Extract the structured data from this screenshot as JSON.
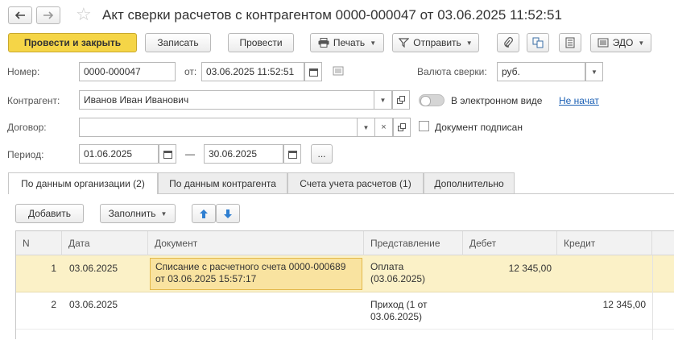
{
  "window": {
    "title": "Акт сверки расчетов с контрагентом 0000-000047 от 03.06.2025 11:52:51"
  },
  "toolbar": {
    "post_close": "Провести и закрыть",
    "write": "Записать",
    "post": "Провести",
    "print": "Печать",
    "send": "Отправить",
    "edo": "ЭДО"
  },
  "form": {
    "number_label": "Номер:",
    "number_value": "0000-000047",
    "from_label": "от:",
    "date_value": "03.06.2025 11:52:51",
    "currency_label": "Валюта сверки:",
    "currency_value": "руб.",
    "counterparty_label": "Контрагент:",
    "counterparty_value": "Иванов Иван Иванович",
    "electronic_label": "В электронном виде",
    "electronic_status": "Не начат",
    "contract_label": "Договор:",
    "contract_value": "",
    "signed_label": "Документ подписан",
    "period_label": "Период:",
    "period_from": "01.06.2025",
    "period_dash": "—",
    "period_to": "30.06.2025",
    "period_more": "..."
  },
  "tabs": [
    {
      "label": "По данным организации (2)"
    },
    {
      "label": "По данным контрагента"
    },
    {
      "label": "Счета учета расчетов (1)"
    },
    {
      "label": "Дополнительно"
    }
  ],
  "table_toolbar": {
    "add": "Добавить",
    "fill": "Заполнить"
  },
  "table": {
    "columns": [
      "N",
      "Дата",
      "Документ",
      "Представление",
      "Дебет",
      "Кредит"
    ],
    "rows": [
      {
        "n": "1",
        "date": "03.06.2025",
        "doc": "Списание с расчетного счета 0000-000689 от 03.06.2025 15:57:17",
        "repr": "Оплата (03.06.2025)",
        "debit": "12 345,00",
        "credit": ""
      },
      {
        "n": "2",
        "date": "03.06.2025",
        "doc": "",
        "repr": "Приход (1 от 03.06.2025)",
        "debit": "",
        "credit": "12 345,00"
      }
    ]
  },
  "colors": {
    "accent": "#f5d547",
    "selected_row": "#fbf1c7",
    "link": "#1a5fb4"
  }
}
